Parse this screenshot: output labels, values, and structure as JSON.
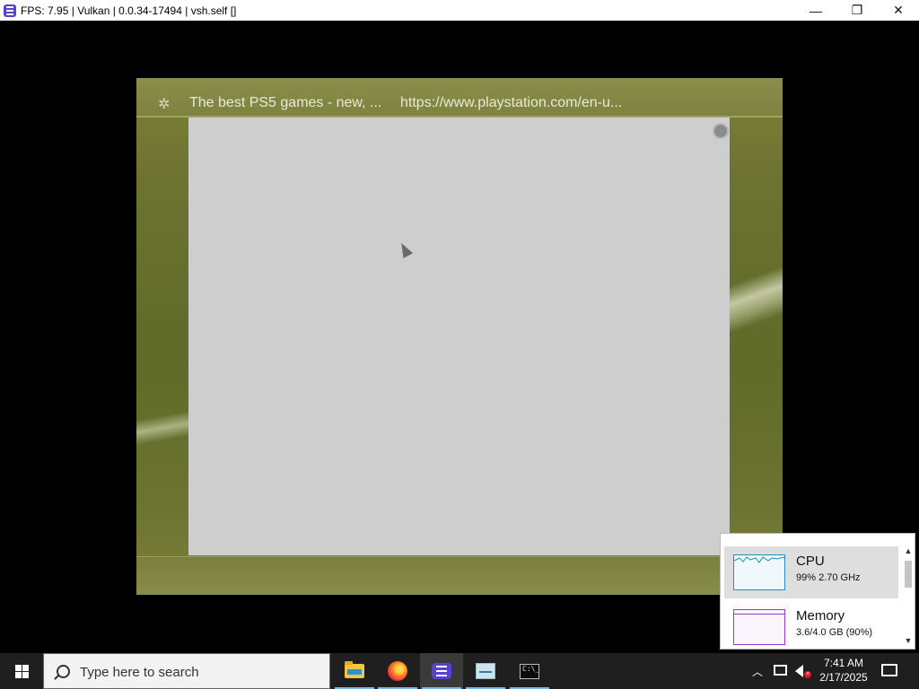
{
  "window": {
    "title": "FPS: 7.95 | Vulkan | 0.0.34-17494 | vsh.self []",
    "controls": {
      "minimize": "—",
      "maximize": "❐",
      "close": "✕"
    }
  },
  "browser": {
    "icon": "browser-icon",
    "tab_title": "The best PS5 games - new, ...",
    "tab_url": "https://www.playstation.com/en-u..."
  },
  "task_manager": {
    "cpu": {
      "name": "CPU",
      "value": "99%  2.70 GHz",
      "percent": 99
    },
    "memory": {
      "name": "Memory",
      "value": "3.6/4.0 GB (90%)",
      "percent": 90
    }
  },
  "taskbar": {
    "search_placeholder": "Type here to search",
    "apps": [
      "file-explorer",
      "firefox",
      "rpcs3",
      "task-manager",
      "command-prompt"
    ],
    "time": "7:41 AM",
    "date": "2/17/2025"
  },
  "colors": {
    "xmb_green": "#6d7231",
    "page_gray": "#cecece",
    "cpu_line": "#1e8fbf",
    "memory_line": "#9b3bc2",
    "taskbar": "#1f1f1f"
  }
}
